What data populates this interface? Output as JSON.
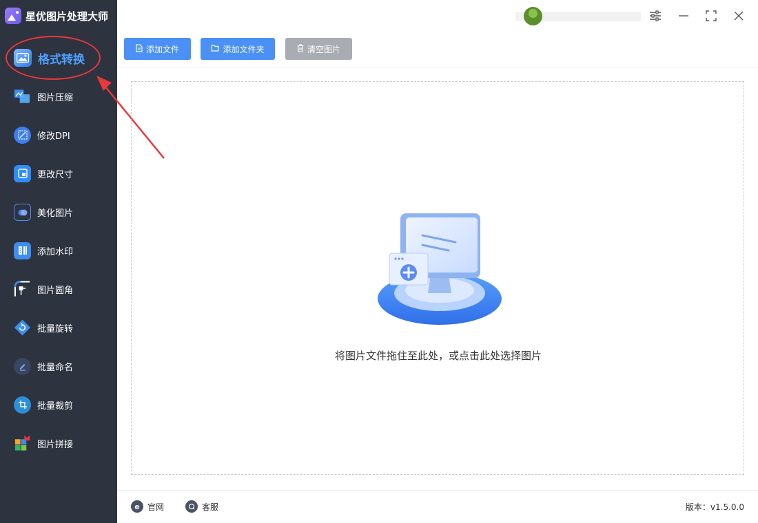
{
  "app": {
    "title": "星优图片处理大师",
    "logo_icon": "app-logo-icon"
  },
  "sidebar": {
    "items": [
      {
        "label": "格式转换",
        "icon": "format-convert-icon",
        "active": true
      },
      {
        "label": "图片压缩",
        "icon": "compress-icon"
      },
      {
        "label": "修改DPI",
        "icon": "dpi-icon"
      },
      {
        "label": "更改尺寸",
        "icon": "resize-icon"
      },
      {
        "label": "美化图片",
        "icon": "beautify-icon"
      },
      {
        "label": "添加水印",
        "icon": "watermark-icon"
      },
      {
        "label": "图片圆角",
        "icon": "rounded-corner-icon"
      },
      {
        "label": "批量旋转",
        "icon": "rotate-icon"
      },
      {
        "label": "批量命名",
        "icon": "rename-icon"
      },
      {
        "label": "批量裁剪",
        "icon": "crop-icon"
      },
      {
        "label": "图片拼接",
        "icon": "stitch-icon"
      }
    ]
  },
  "toolbar": {
    "add_file": "添加文件",
    "add_folder": "添加文件夹",
    "clear_images": "清空图片"
  },
  "dropzone": {
    "hint": "将图片文件拖住至此处，或点击此处选择图片"
  },
  "footer": {
    "website": "官网",
    "service": "客服",
    "version": "版本：v1.5.0.0"
  },
  "colors": {
    "sidebar_bg": "#2e3340",
    "accent": "#4a90f5",
    "active_text": "#4ea0ff",
    "annotation_red": "#e8383a"
  }
}
